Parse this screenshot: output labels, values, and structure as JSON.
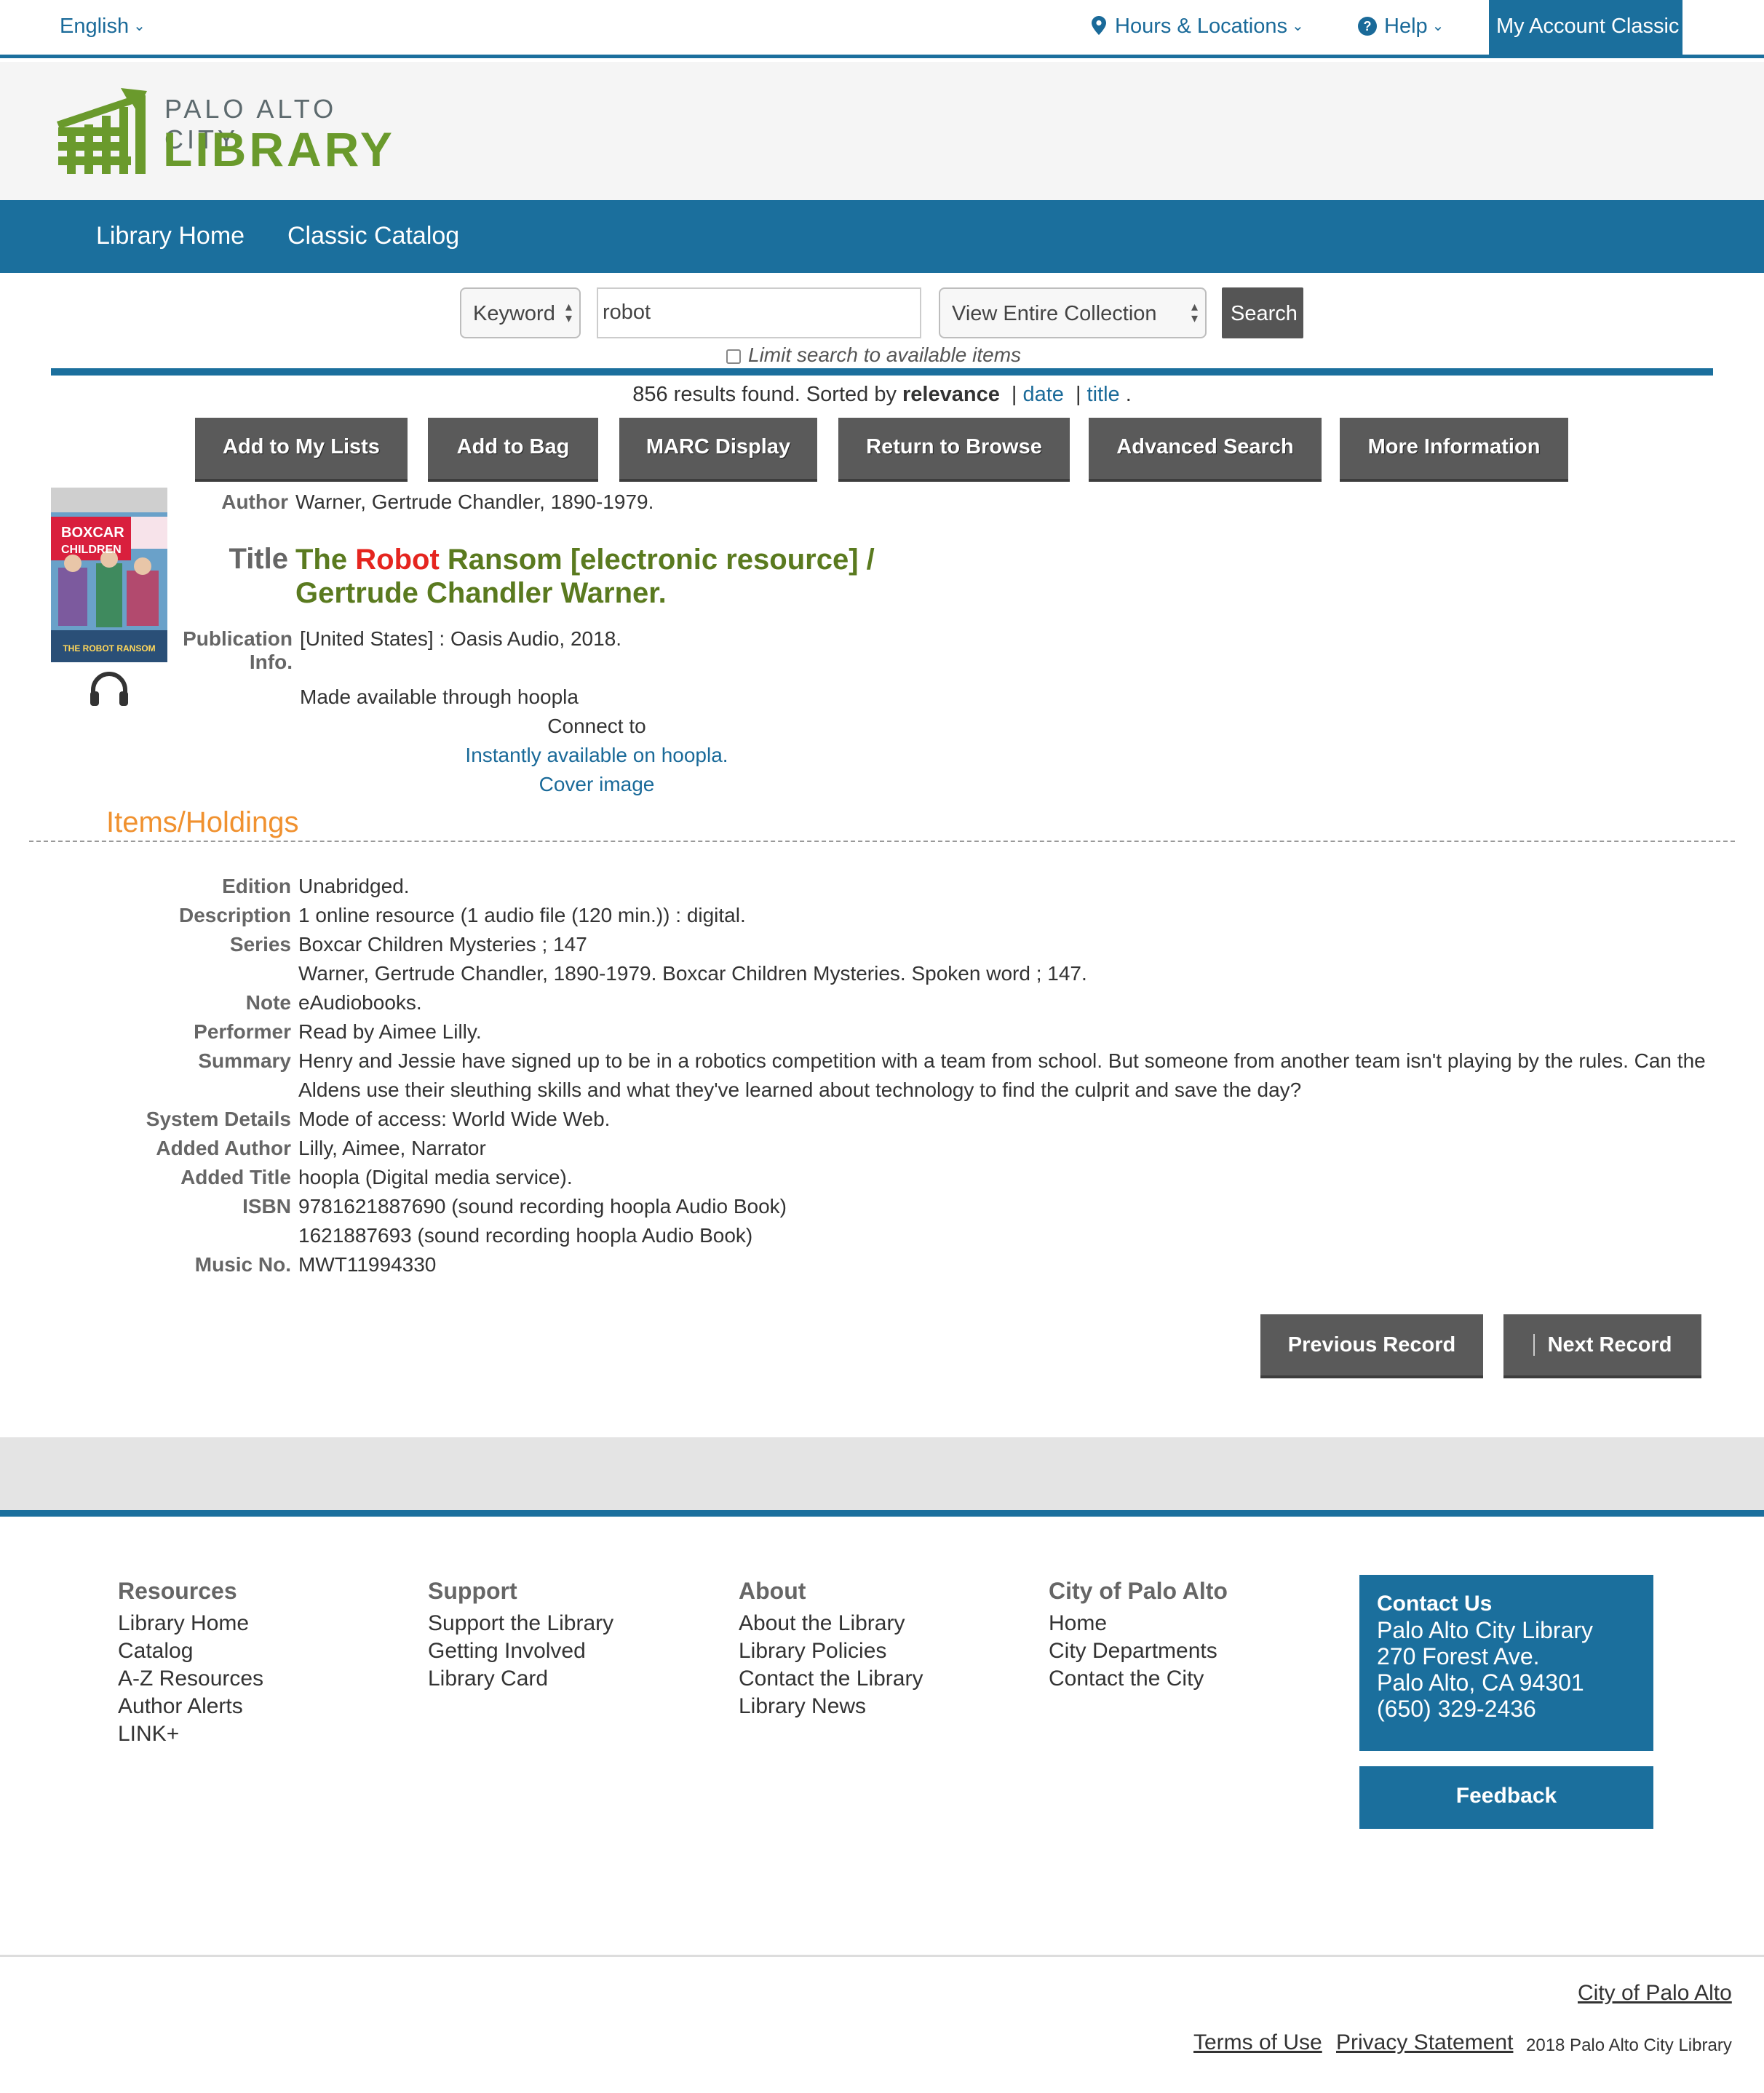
{
  "topbar": {
    "language": "English",
    "hours": "Hours & Locations",
    "help": "Help",
    "account": "My Account Classic"
  },
  "logo": {
    "line1": "PALO ALTO CITY",
    "line2": "LIBRARY",
    "brand_color": "#6a9a2c"
  },
  "nav": {
    "items": [
      "Library Home",
      "Classic Catalog"
    ]
  },
  "search": {
    "type": "Keyword",
    "query": "robot",
    "scope": "View Entire Collection",
    "button": "Search",
    "limit_label": "Limit search to available items"
  },
  "results": {
    "text": "856 results found. Sorted by",
    "sort_current": "relevance",
    "sort_date": "date",
    "sort_title": "title",
    "sep": "|",
    "period": "."
  },
  "actions": [
    "Add to My Lists",
    "Add to Bag",
    "MARC Display",
    "Return to Browse",
    "Advanced Search",
    "More Information"
  ],
  "record": {
    "cover_line1": "BOXCAR",
    "cover_line2": "CHILDREN",
    "cover_caption": "THE ROBOT RANSOM",
    "author_label": "Author",
    "author": "Warner, Gertrude Chandler, 1890-1979.",
    "title_label": "Title",
    "title_the": "The",
    "title_highlight": "Robot",
    "title_rest": "Ransom [electronic resource] /",
    "title_line2": "Gertrude Chandler Warner.",
    "pub_label_1": "Publication",
    "pub_label_2": "Info.",
    "publication": "[United States] : Oasis Audio, 2018.",
    "made_available": "Made available through hoopla",
    "connect_to": "Connect to",
    "instantly": "Instantly available on hoopla.",
    "cover_image": "Cover image"
  },
  "holdings_heading": "Items/Holdings",
  "details": {
    "edition_label": "Edition",
    "edition": "Unabridged.",
    "description_label": "Description",
    "description": "1 online resource (1 audio file (120 min.)) : digital.",
    "series_label": "Series",
    "series": "Boxcar Children Mysteries ; 147",
    "series_link": "Warner, Gertrude Chandler, 1890-1979. Boxcar Children Mysteries. Spoken word ; 147.",
    "note_label": "Note",
    "note": "eAudiobooks.",
    "performer_label": "Performer",
    "performer": "Read by Aimee Lilly.",
    "summary_label": "Summary",
    "summary_1": "Henry and Jessie have signed up to be in a robotics competition with a team from school. But someone from another team isn't playing by the rules. Can the",
    "summary_2": "Aldens use their sleuthing skills and what they've learned about technology to find the culprit and save the day?",
    "system_label": "System Details",
    "system": "Mode of access: World Wide Web.",
    "added_author_label": "Added Author",
    "added_author": "Lilly, Aimee, Narrator",
    "added_title_label": "Added Title",
    "added_title": "hoopla (Digital media service).",
    "isbn_label": "ISBN",
    "isbn_1": "9781621887690 (sound recording hoopla Audio Book)",
    "isbn_2": "1621887693 (sound recording hoopla Audio Book)",
    "music_label": "Music No.",
    "music": "MWT11994330"
  },
  "record_nav": {
    "previous": "Previous Record",
    "next": "Next Record"
  },
  "footer": {
    "resources": {
      "heading": "Resources",
      "items": [
        "Library Home",
        "Catalog",
        "A-Z Resources",
        "Author Alerts",
        "LINK+"
      ]
    },
    "support": {
      "heading": "Support",
      "items": [
        "Support the Library",
        "Getting Involved",
        "Library Card"
      ]
    },
    "about": {
      "heading": "About",
      "items": [
        "About the Library",
        "Library Policies",
        "Contact the Library",
        "Library News"
      ]
    },
    "city": {
      "heading": "City of Palo Alto",
      "items": [
        "Home",
        "City Departments",
        "Contact the City"
      ]
    },
    "contact": {
      "heading": "Contact Us",
      "name": "Palo Alto City Library",
      "street": "270 Forest Ave.",
      "city": "Palo Alto, CA 94301",
      "phone": "(650) 329-2436"
    },
    "feedback": "Feedback",
    "city_link": "City of Palo Alto",
    "terms": "Terms of Use",
    "privacy": "Privacy Statement",
    "copyright": "2018 Palo Alto City Library"
  },
  "colors": {
    "primary": "#1b6f9d",
    "accent_orange": "#f0912f",
    "title_green": "#5a7a1f",
    "highlight_red": "#e5251f"
  }
}
